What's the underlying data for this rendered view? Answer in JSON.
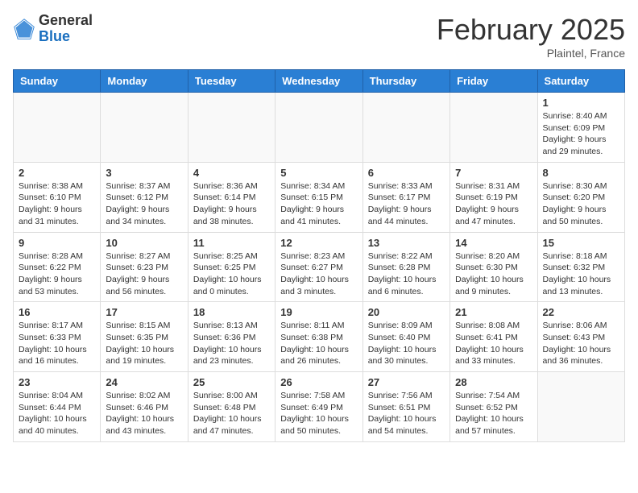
{
  "header": {
    "logo_general": "General",
    "logo_blue": "Blue",
    "month_title": "February 2025",
    "location": "Plaintel, France"
  },
  "days_of_week": [
    "Sunday",
    "Monday",
    "Tuesday",
    "Wednesday",
    "Thursday",
    "Friday",
    "Saturday"
  ],
  "weeks": [
    [
      {
        "day": "",
        "info": ""
      },
      {
        "day": "",
        "info": ""
      },
      {
        "day": "",
        "info": ""
      },
      {
        "day": "",
        "info": ""
      },
      {
        "day": "",
        "info": ""
      },
      {
        "day": "",
        "info": ""
      },
      {
        "day": "1",
        "info": "Sunrise: 8:40 AM\nSunset: 6:09 PM\nDaylight: 9 hours and 29 minutes."
      }
    ],
    [
      {
        "day": "2",
        "info": "Sunrise: 8:38 AM\nSunset: 6:10 PM\nDaylight: 9 hours and 31 minutes."
      },
      {
        "day": "3",
        "info": "Sunrise: 8:37 AM\nSunset: 6:12 PM\nDaylight: 9 hours and 34 minutes."
      },
      {
        "day": "4",
        "info": "Sunrise: 8:36 AM\nSunset: 6:14 PM\nDaylight: 9 hours and 38 minutes."
      },
      {
        "day": "5",
        "info": "Sunrise: 8:34 AM\nSunset: 6:15 PM\nDaylight: 9 hours and 41 minutes."
      },
      {
        "day": "6",
        "info": "Sunrise: 8:33 AM\nSunset: 6:17 PM\nDaylight: 9 hours and 44 minutes."
      },
      {
        "day": "7",
        "info": "Sunrise: 8:31 AM\nSunset: 6:19 PM\nDaylight: 9 hours and 47 minutes."
      },
      {
        "day": "8",
        "info": "Sunrise: 8:30 AM\nSunset: 6:20 PM\nDaylight: 9 hours and 50 minutes."
      }
    ],
    [
      {
        "day": "9",
        "info": "Sunrise: 8:28 AM\nSunset: 6:22 PM\nDaylight: 9 hours and 53 minutes."
      },
      {
        "day": "10",
        "info": "Sunrise: 8:27 AM\nSunset: 6:23 PM\nDaylight: 9 hours and 56 minutes."
      },
      {
        "day": "11",
        "info": "Sunrise: 8:25 AM\nSunset: 6:25 PM\nDaylight: 10 hours and 0 minutes."
      },
      {
        "day": "12",
        "info": "Sunrise: 8:23 AM\nSunset: 6:27 PM\nDaylight: 10 hours and 3 minutes."
      },
      {
        "day": "13",
        "info": "Sunrise: 8:22 AM\nSunset: 6:28 PM\nDaylight: 10 hours and 6 minutes."
      },
      {
        "day": "14",
        "info": "Sunrise: 8:20 AM\nSunset: 6:30 PM\nDaylight: 10 hours and 9 minutes."
      },
      {
        "day": "15",
        "info": "Sunrise: 8:18 AM\nSunset: 6:32 PM\nDaylight: 10 hours and 13 minutes."
      }
    ],
    [
      {
        "day": "16",
        "info": "Sunrise: 8:17 AM\nSunset: 6:33 PM\nDaylight: 10 hours and 16 minutes."
      },
      {
        "day": "17",
        "info": "Sunrise: 8:15 AM\nSunset: 6:35 PM\nDaylight: 10 hours and 19 minutes."
      },
      {
        "day": "18",
        "info": "Sunrise: 8:13 AM\nSunset: 6:36 PM\nDaylight: 10 hours and 23 minutes."
      },
      {
        "day": "19",
        "info": "Sunrise: 8:11 AM\nSunset: 6:38 PM\nDaylight: 10 hours and 26 minutes."
      },
      {
        "day": "20",
        "info": "Sunrise: 8:09 AM\nSunset: 6:40 PM\nDaylight: 10 hours and 30 minutes."
      },
      {
        "day": "21",
        "info": "Sunrise: 8:08 AM\nSunset: 6:41 PM\nDaylight: 10 hours and 33 minutes."
      },
      {
        "day": "22",
        "info": "Sunrise: 8:06 AM\nSunset: 6:43 PM\nDaylight: 10 hours and 36 minutes."
      }
    ],
    [
      {
        "day": "23",
        "info": "Sunrise: 8:04 AM\nSunset: 6:44 PM\nDaylight: 10 hours and 40 minutes."
      },
      {
        "day": "24",
        "info": "Sunrise: 8:02 AM\nSunset: 6:46 PM\nDaylight: 10 hours and 43 minutes."
      },
      {
        "day": "25",
        "info": "Sunrise: 8:00 AM\nSunset: 6:48 PM\nDaylight: 10 hours and 47 minutes."
      },
      {
        "day": "26",
        "info": "Sunrise: 7:58 AM\nSunset: 6:49 PM\nDaylight: 10 hours and 50 minutes."
      },
      {
        "day": "27",
        "info": "Sunrise: 7:56 AM\nSunset: 6:51 PM\nDaylight: 10 hours and 54 minutes."
      },
      {
        "day": "28",
        "info": "Sunrise: 7:54 AM\nSunset: 6:52 PM\nDaylight: 10 hours and 57 minutes."
      },
      {
        "day": "",
        "info": ""
      }
    ]
  ]
}
